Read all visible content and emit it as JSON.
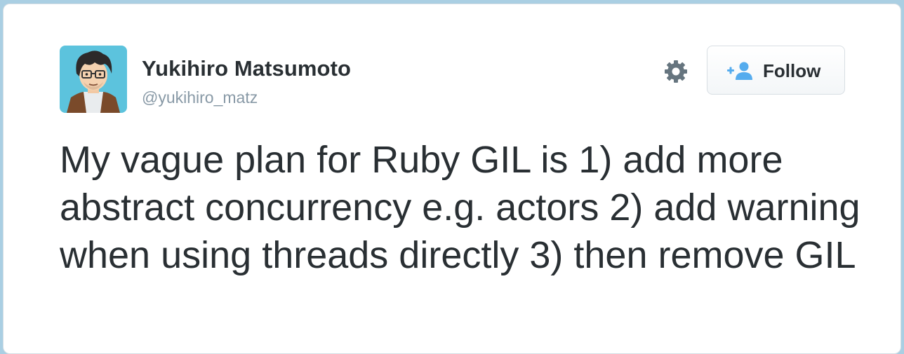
{
  "tweet": {
    "author": {
      "display_name": "Yukihiro Matsumoto",
      "handle": "@yukihiro_matz",
      "avatar_icon": "avatar-illustration"
    },
    "actions": {
      "settings_icon": "gear-icon",
      "follow_icon": "add-user-icon",
      "follow_label": "Follow"
    },
    "text": "My vague plan for Ruby GIL is 1) add more abstract concurrency e.g. actors 2) add warning when using threads directly 3) then remove GIL"
  },
  "colors": {
    "page_background": "#aacfe3",
    "text": "#292f33",
    "secondary_text": "#8899a6",
    "follow_icon": "#55acee",
    "gear_icon": "#66757f"
  }
}
